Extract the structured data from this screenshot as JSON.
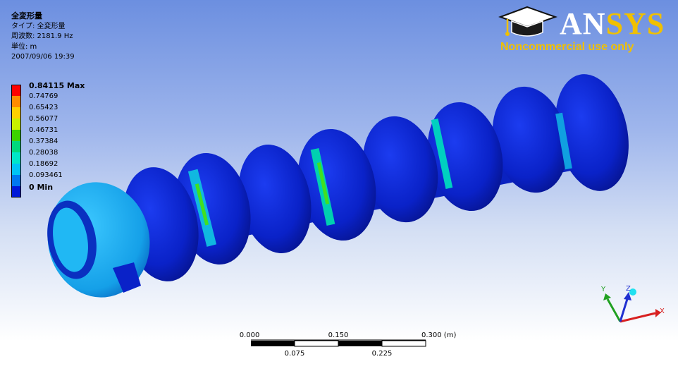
{
  "info": {
    "title": "全変形量",
    "type_line": "タイプ: 全変形量",
    "frequency_line": "周波数: 2181.9 Hz",
    "unit_line": "単位: m",
    "datetime": "2007/09/06 19:39"
  },
  "legend": {
    "items": [
      {
        "label": "0.84115 Max",
        "color": "#ff0000",
        "bold": true
      },
      {
        "label": "0.74769",
        "color": "#ff8c00",
        "bold": false
      },
      {
        "label": "0.65423",
        "color": "#ffd000",
        "bold": false
      },
      {
        "label": "0.56077",
        "color": "#c8f000",
        "bold": false
      },
      {
        "label": "0.46731",
        "color": "#3cd200",
        "bold": false
      },
      {
        "label": "0.37384",
        "color": "#00d87c",
        "bold": false
      },
      {
        "label": "0.28038",
        "color": "#00e6c8",
        "bold": false
      },
      {
        "label": "0.18692",
        "color": "#00c4f4",
        "bold": false
      },
      {
        "label": "0.093461",
        "color": "#0078f0",
        "bold": false
      },
      {
        "label": "0 Min",
        "color": "#0018d8",
        "bold": true
      }
    ]
  },
  "logo": {
    "brand_prefix": "AN",
    "brand_suffix": "SYS",
    "subtitle": "Noncommercial use only",
    "icon": "graduation-cap-icon"
  },
  "scale_bar": {
    "top_labels": [
      "0.000",
      "0.150",
      "0.300 (m)"
    ],
    "bottom_labels": [
      "0.075",
      "0.225"
    ]
  },
  "triad": {
    "x_label": "X",
    "y_label": "Y",
    "z_label": "Z",
    "x_color": "#d82020",
    "y_color": "#20a020",
    "z_color": "#2030d0"
  },
  "model": {
    "main_color": "#0a20c8",
    "light_color": "#20a8ec",
    "highlight_color": "#00dcd0",
    "accent_color": "#40e020"
  }
}
